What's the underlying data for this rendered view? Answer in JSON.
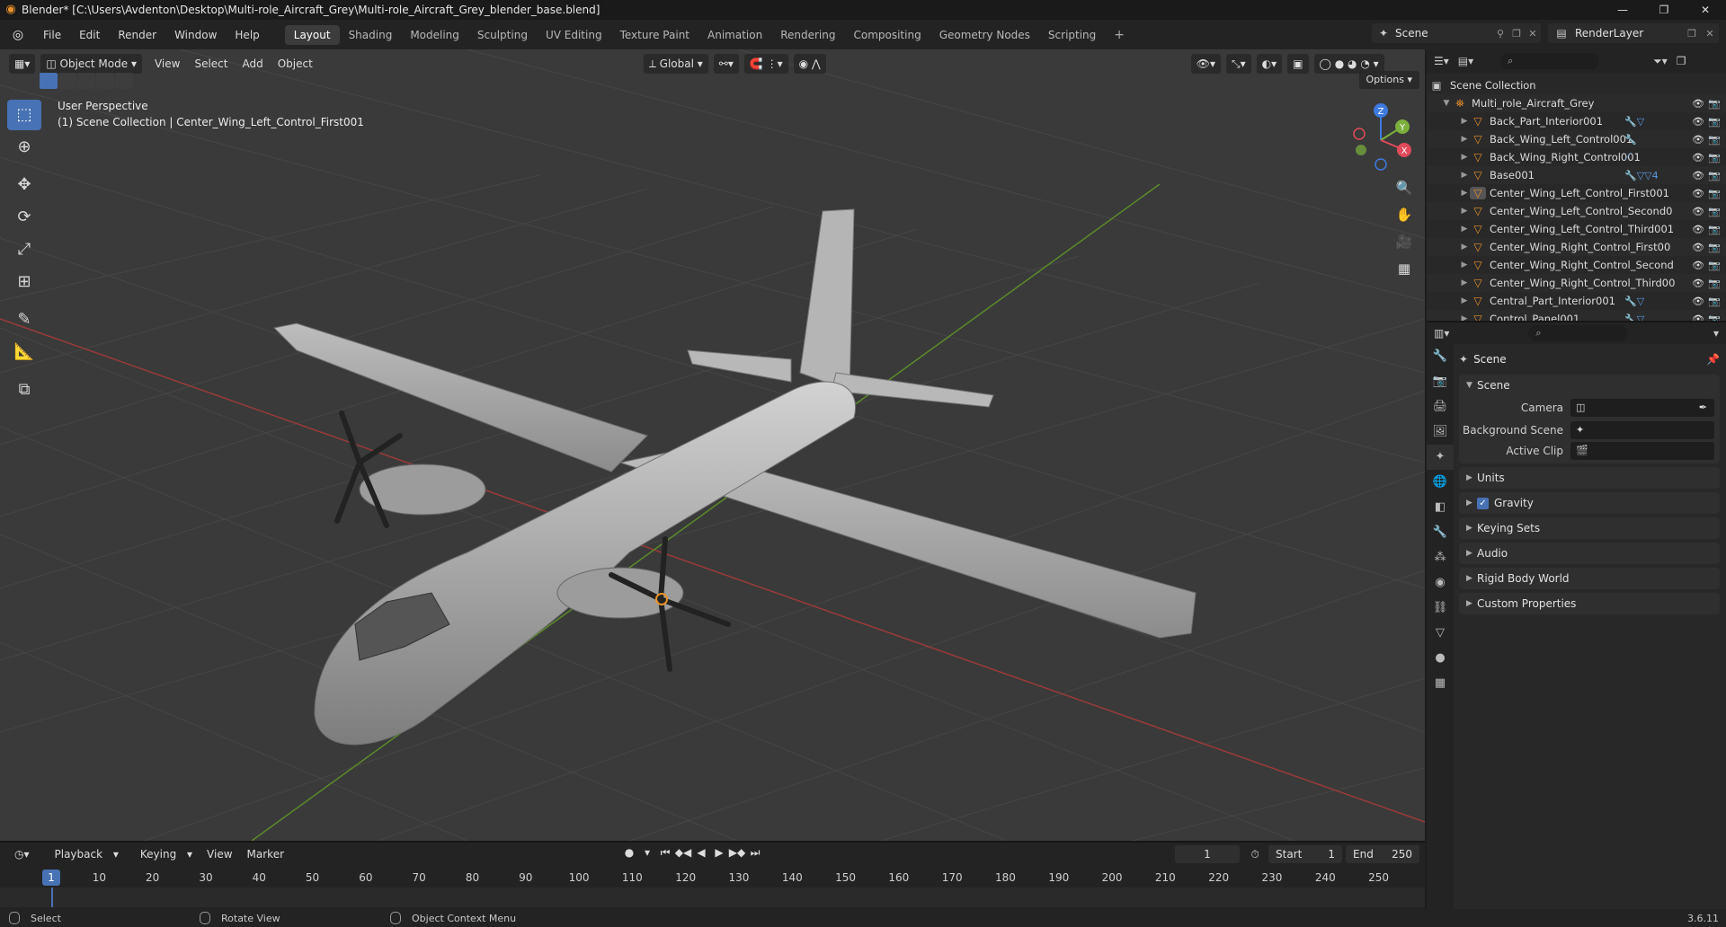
{
  "window": {
    "title": "Blender* [C:\\Users\\Avdenton\\Desktop\\Multi-role_Aircraft_Grey\\Multi-role_Aircraft_Grey_blender_base.blend]",
    "minimize": "—",
    "maximize": "❐",
    "close": "✕"
  },
  "menu": [
    "File",
    "Edit",
    "Render",
    "Window",
    "Help"
  ],
  "workspaces": [
    "Layout",
    "Shading",
    "Modeling",
    "Sculpting",
    "UV Editing",
    "Texture Paint",
    "Animation",
    "Rendering",
    "Compositing",
    "Geometry Nodes",
    "Scripting"
  ],
  "workspace_add": "+",
  "scene_name": "Scene",
  "render_layer": "RenderLayer",
  "viewport": {
    "mode": "Object Mode",
    "menus": [
      "View",
      "Select",
      "Add",
      "Object"
    ],
    "orientation": "Global",
    "options": "Options",
    "perspective": "User Perspective",
    "context": "(1) Scene Collection | Center_Wing_Left_Control_First001",
    "gizmo": {
      "x": "X",
      "y": "Y",
      "z": "Z"
    }
  },
  "timeline": {
    "menus": [
      "Playback",
      "Keying",
      "View",
      "Marker"
    ],
    "current_frame": "1",
    "start_label": "Start",
    "start": "1",
    "end_label": "End",
    "end": "250",
    "ruler": [
      "1",
      "10",
      "20",
      "30",
      "40",
      "50",
      "60",
      "70",
      "80",
      "90",
      "100",
      "110",
      "120",
      "130",
      "140",
      "150",
      "160",
      "170",
      "180",
      "190",
      "200",
      "210",
      "220",
      "230",
      "240",
      "250"
    ]
  },
  "status": {
    "select": "Select",
    "rotate": "Rotate View",
    "context_menu": "Object Context Menu",
    "version": "3.6.11"
  },
  "outliner": {
    "root": "Scene Collection",
    "collection": "Multi_role_Aircraft_Grey",
    "items": [
      {
        "name": "Back_Part_Interior001",
        "mods": "🔧▽"
      },
      {
        "name": "Back_Wing_Left_Control001",
        "mods": "🔧"
      },
      {
        "name": "Back_Wing_Right_Control001",
        "mods": "⟋"
      },
      {
        "name": "Base001",
        "mods": "🔧▽▽4"
      },
      {
        "name": "Center_Wing_Left_Control_First001",
        "mods": ""
      },
      {
        "name": "Center_Wing_Left_Control_Second0",
        "mods": ""
      },
      {
        "name": "Center_Wing_Left_Control_Third001",
        "mods": ""
      },
      {
        "name": "Center_Wing_Right_Control_First00",
        "mods": ""
      },
      {
        "name": "Center_Wing_Right_Control_Second",
        "mods": ""
      },
      {
        "name": "Center_Wing_Right_Control_Third00",
        "mods": ""
      },
      {
        "name": "Central_Part_Interior001",
        "mods": "🔧▽"
      },
      {
        "name": "Control_Panel001",
        "mods": "🔧▽"
      }
    ]
  },
  "properties": {
    "context": "Scene",
    "panel_scene": "Scene",
    "camera_label": "Camera",
    "background_label": "Background Scene",
    "clip_label": "Active Clip",
    "panels": [
      "Units",
      "Gravity",
      "Keying Sets",
      "Audio",
      "Rigid Body World",
      "Custom Properties"
    ]
  }
}
